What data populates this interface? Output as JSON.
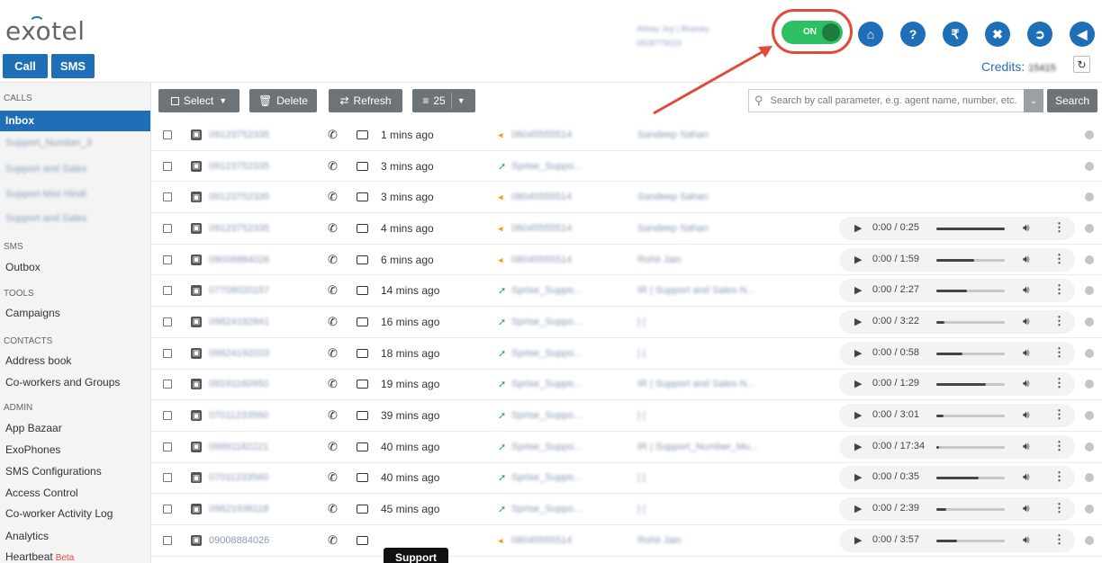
{
  "header": {
    "logo": "exotel",
    "call_label": "Call",
    "sms_label": "SMS",
    "account_line1": "Abhay Joy | Bluesky",
    "account_line2": "0928779010",
    "toggle_label": "ON",
    "credits_label": "Credits:",
    "credits_value": "15415",
    "icons": [
      "home-icon",
      "help-icon",
      "rupee-icon",
      "tools-icon",
      "logout-icon",
      "announcement-icon"
    ],
    "accent_color": "#1f6fb8",
    "toggle_color": "#2dc062",
    "highlight_color": "#e14b3b"
  },
  "sidebar": {
    "calls_heading": "CALLS",
    "inbox": "Inbox",
    "blurred_items": [
      "Support_Number_3",
      "Support and Sales",
      "Support Mss Hindi",
      "Support and Sales"
    ],
    "sms_heading": "SMS",
    "outbox": "Outbox",
    "tools_heading": "TOOLS",
    "campaigns": "Campaigns",
    "contacts_heading": "CONTACTS",
    "address_book": "Address book",
    "coworkers": "Co-workers and Groups",
    "admin_heading": "ADMIN",
    "app_bazaar": "App Bazaar",
    "exophones": "ExoPhones",
    "sms_config": "SMS Configurations",
    "access_control": "Access Control",
    "coworker_log": "Co-worker Activity Log",
    "analytics": "Analytics",
    "heartbeat": "Heartbeat",
    "beta": "Beta"
  },
  "toolbar": {
    "select": "Select",
    "delete": "Delete",
    "refresh": "Refresh",
    "page_size": "25",
    "search_placeholder": "Search by call parameter, e.g. agent name, number, etc.",
    "search_button": "Search"
  },
  "rows": [
    {
      "number": "09123752335",
      "time": "1 mins ago",
      "dir": "in",
      "via": "08045555514",
      "to": "Sandeep Sahan",
      "player": null
    },
    {
      "number": "09123752335",
      "time": "3 mins ago",
      "dir": "out",
      "via": "Sprise_Suppo...",
      "to": "",
      "player": null
    },
    {
      "number": "09123752335",
      "time": "3 mins ago",
      "dir": "in",
      "via": "08045555514",
      "to": "Sandeep Sahan",
      "player": null
    },
    {
      "number": "09123752335",
      "time": "4 mins ago",
      "dir": "in",
      "via": "08045555514",
      "to": "Sandeep Sahan",
      "player": {
        "time": "0:00 / 0:25",
        "progress": 1.0
      }
    },
    {
      "number": "09008884026",
      "time": "6 mins ago",
      "dir": "in",
      "via": "08045555514",
      "to": "Rohit Jain",
      "player": {
        "time": "0:00 / 1:59",
        "progress": 0.55
      }
    },
    {
      "number": "07708020157",
      "time": "14 mins ago",
      "dir": "out",
      "via": "Sprise_Suppo...",
      "to": "IR | Support and Sales N...",
      "player": {
        "time": "0:00 / 2:27",
        "progress": 0.45
      }
    },
    {
      "number": "09824192841",
      "time": "16 mins ago",
      "dir": "out",
      "via": "Sprise_Suppo...",
      "to": "| |",
      "player": {
        "time": "0:00 / 3:22",
        "progress": 0.12
      }
    },
    {
      "number": "09824192033",
      "time": "18 mins ago",
      "dir": "out",
      "via": "Sprise_Suppo...",
      "to": "| |",
      "player": {
        "time": "0:00 / 0:58",
        "progress": 0.38
      }
    },
    {
      "number": "09191160950",
      "time": "19 mins ago",
      "dir": "out",
      "via": "Sprise_Suppo...",
      "to": "IR | Support and Sales N...",
      "player": {
        "time": "0:00 / 1:29",
        "progress": 0.72
      }
    },
    {
      "number": "07011233560",
      "time": "39 mins ago",
      "dir": "out",
      "via": "Sprise_Suppo...",
      "to": "| |",
      "player": {
        "time": "0:00 / 3:01",
        "progress": 0.1
      }
    },
    {
      "number": "09891182221",
      "time": "40 mins ago",
      "dir": "out",
      "via": "Sprise_Suppo...",
      "to": "IR | Support_Number_Mu...",
      "player": {
        "time": "0:00 / 17:34",
        "progress": 0.04
      }
    },
    {
      "number": "07011233560",
      "time": "40 mins ago",
      "dir": "out",
      "via": "Sprise_Suppo...",
      "to": "| |",
      "player": {
        "time": "0:00 / 0:35",
        "progress": 0.62
      }
    },
    {
      "number": "09821938118",
      "time": "45 mins ago",
      "dir": "out",
      "via": "Sprise_Suppo...",
      "to": "| |",
      "player": {
        "time": "0:00 / 2:39",
        "progress": 0.14
      }
    },
    {
      "number": "09008884026",
      "time": "",
      "dir": "in",
      "via": "08045555514",
      "to": "Rohit Jain",
      "player": {
        "time": "0:00 / 3:57",
        "progress": 0.3
      }
    }
  ],
  "tooltip": "Support"
}
